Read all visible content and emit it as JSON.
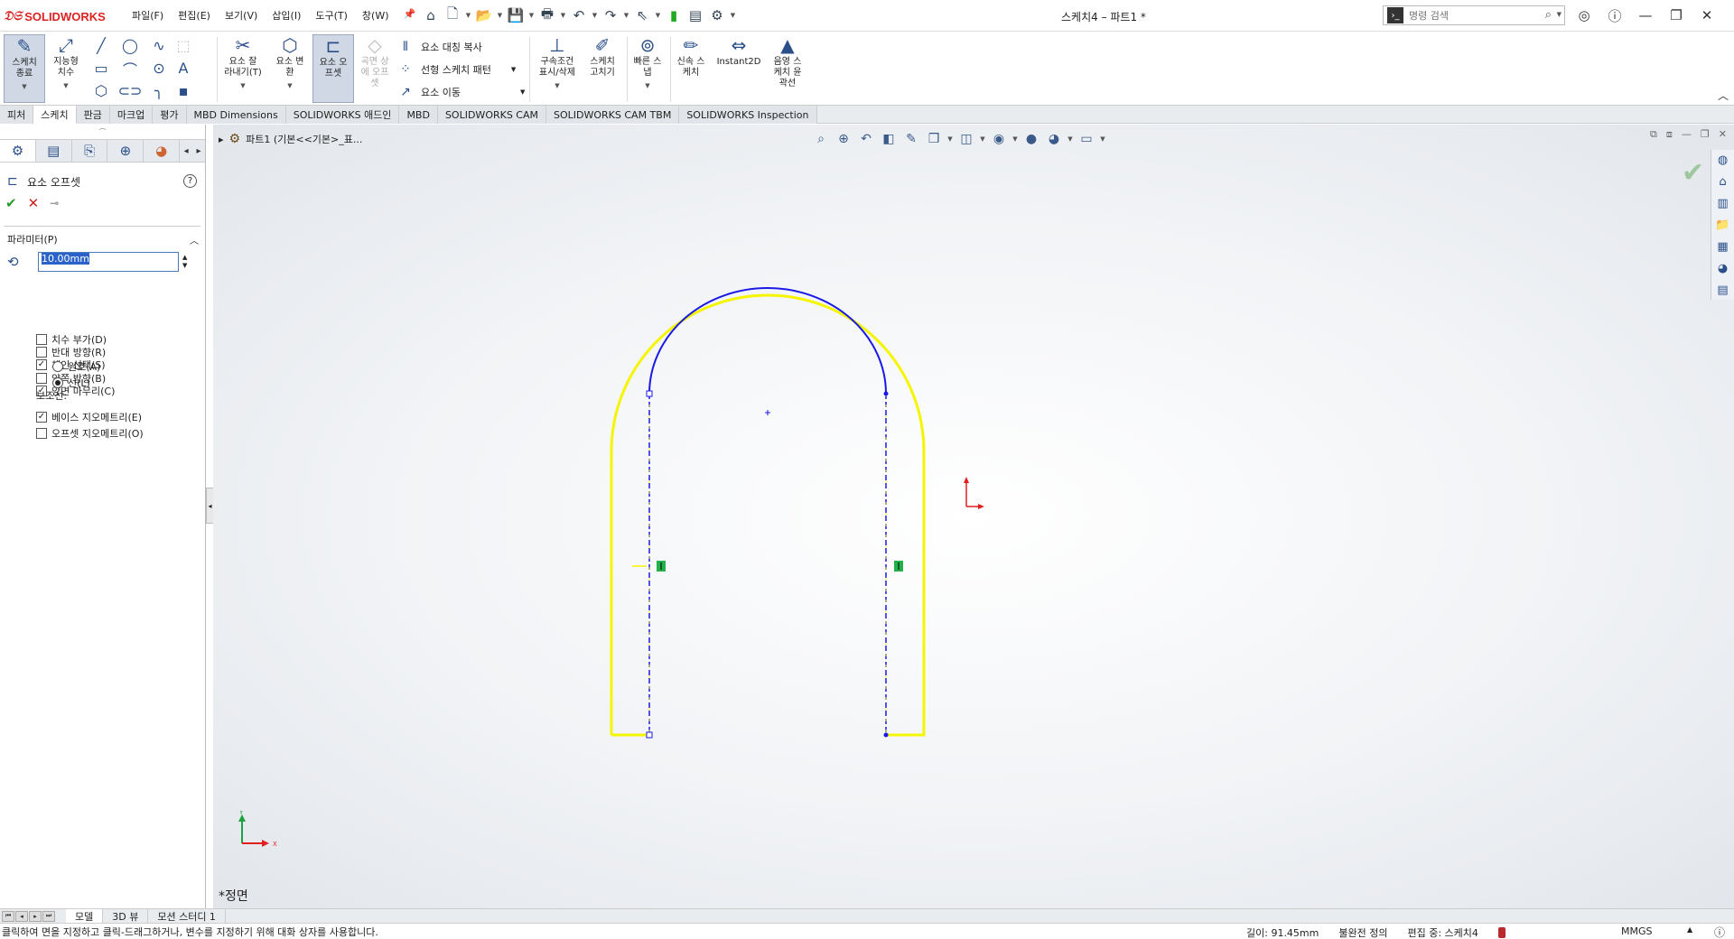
{
  "app": {
    "brand": "SOLIDWORKS",
    "doc_title": "스케치4 – 파트1 *"
  },
  "menu": [
    "파일(F)",
    "편집(E)",
    "보기(V)",
    "삽입(I)",
    "도구(T)",
    "창(W)"
  ],
  "search": {
    "placeholder": "명령 검색"
  },
  "command_manager": {
    "exit_sketch": "스케치\n종료",
    "smart_dimension": "지능형\n치수",
    "trim": "요소 잘\n라내기(T)",
    "convert": "요소 변\n환",
    "offset": "요소 오\n프셋",
    "offset_surface": "곡면 상\n에 오프\n셋",
    "mirror": "요소 대칭 복사",
    "linear_pattern": "선형 스케치 패턴",
    "move": "요소 이동",
    "relations": "구속조건\n표시/삭제",
    "repair": "스케치\n고치기",
    "quick_snaps": "빠른 스\n냅",
    "rapid_sketch": "신속 스\n케치",
    "instant2d": "Instant2D",
    "shaded_contours": "음영 스\n케치 윤\n곽선"
  },
  "tabs": [
    {
      "label": "피처",
      "active": false
    },
    {
      "label": "스케치",
      "active": true
    },
    {
      "label": "판금",
      "active": false
    },
    {
      "label": "마크업",
      "active": false
    },
    {
      "label": "평가",
      "active": false
    },
    {
      "label": "MBD Dimensions",
      "active": false
    },
    {
      "label": "SOLIDWORKS 애드인",
      "active": false
    },
    {
      "label": "MBD",
      "active": false
    },
    {
      "label": "SOLIDWORKS CAM",
      "active": false
    },
    {
      "label": "SOLIDWORKS CAM TBM",
      "active": false
    },
    {
      "label": "SOLIDWORKS Inspection",
      "active": false
    }
  ],
  "property_manager": {
    "title": "요소 오프셋",
    "params_header": "파라미터(P)",
    "offset_value": "10.00mm",
    "options": [
      {
        "label": "치수 부가(D)",
        "checked": false
      },
      {
        "label": "반대 방향(R)",
        "checked": false
      },
      {
        "label": "체인 선택(S)",
        "checked": true
      },
      {
        "label": "양쪽 방향(B)",
        "checked": false
      },
      {
        "label": "양면 마무리(C)",
        "checked": true
      }
    ],
    "cap_options": [
      {
        "label": "원호(A)",
        "selected": false
      },
      {
        "label": "선(L)",
        "selected": true
      }
    ],
    "construction_label": "보조선:",
    "construction_options": [
      {
        "label": "베이스 지오메트리(E)",
        "checked": true
      },
      {
        "label": "오프셋 지오메트리(O)",
        "checked": false
      }
    ]
  },
  "graphics": {
    "tree_crumb": "파트1  (기본<<기본>_표...",
    "view_name": "*정면",
    "triad_x": "X",
    "triad_y": "Y"
  },
  "bottom_tabs": [
    {
      "label": "모델",
      "active": true
    },
    {
      "label": "3D 뷰",
      "active": false
    },
    {
      "label": "모션 스터디 1",
      "active": false
    }
  ],
  "status": {
    "message": "클릭하여 면을 지정하고 클릭-드래그하거나, 변수를 지정하기 위해 대화 상자를 사용합니다.",
    "length": "길이: 91.45mm",
    "definition": "불완전 정의",
    "editing": "편집 중: 스케치4",
    "units": "MMGS"
  },
  "colors": {
    "sketch_blue": "#1a1ae6",
    "offset_yellow": "#f5f500",
    "relation_green": "#22b04a",
    "origin_red": "#e02020",
    "brand_red": "#d22222"
  }
}
